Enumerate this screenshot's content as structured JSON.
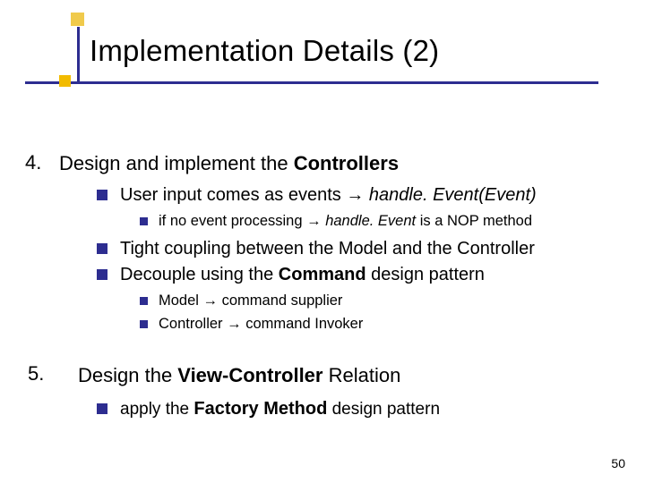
{
  "title": "Implementation Details (2)",
  "item4": {
    "num": "4.",
    "text_a": "Design and implement the ",
    "text_b": "Controllers",
    "sub1": {
      "a": "User input comes as events ",
      "arrow": "→",
      "b": " handle. Event(Event)",
      "sub": {
        "a": "if no event processing ",
        "arrow": "→",
        "b": " handle. Event ",
        "c": "is a NOP method"
      }
    },
    "sub2": "Tight coupling between the Model and the Controller",
    "sub3": {
      "a": "Decouple using the ",
      "b": "Command",
      "c": " design pattern",
      "subA": {
        "a": "Model ",
        "arrow": "→",
        "b": " command supplier"
      },
      "subB": {
        "a": "Controller ",
        "arrow": "→",
        "b": " command Invoker"
      }
    }
  },
  "item5": {
    "num": "5.",
    "a": "Design the ",
    "b": "View-Controller",
    "c": " Relation",
    "sub": {
      "a": "apply the ",
      "b": "Factory Method",
      "c": " design pattern"
    }
  },
  "page": "50"
}
